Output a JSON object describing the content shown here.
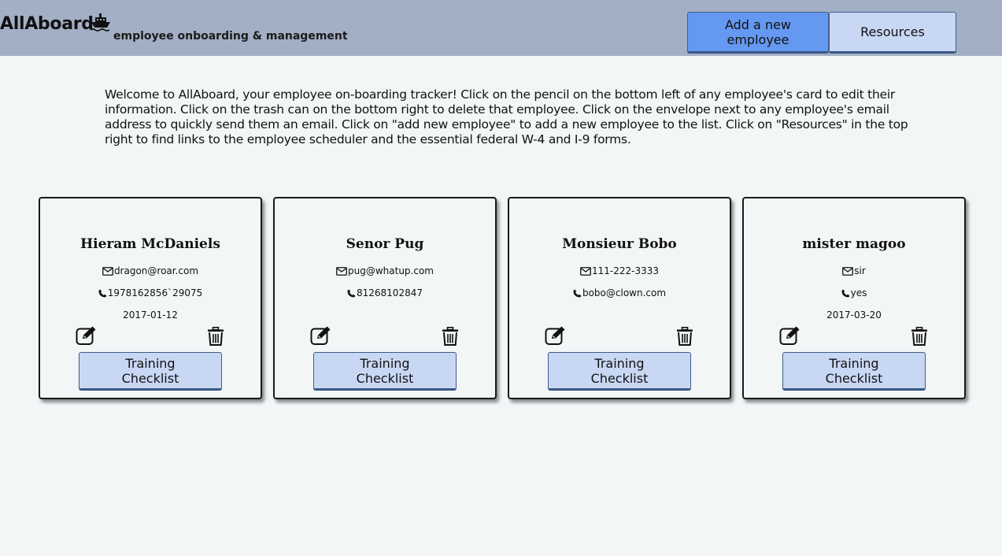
{
  "header": {
    "brand": "AllAboard",
    "tagline": "employee onboarding & management",
    "add_button": "Add a new employee",
    "resources_button": "Resources"
  },
  "welcome_text": "Welcome to AllAboard, your employee on-boarding tracker! Click on the pencil on the bottom left of any employee's card to edit their information. Click on the trash can on the bottom right to delete that employee. Click on the envelope next to any employee's email address to quickly send them an email. Click on \"add new employee\" to add a new employee to the list. Click on \"Resources\" in the top right to find links to the employee scheduler and the essential federal W-4 and I-9 forms.",
  "employees": [
    {
      "name": "Hieram McDaniels",
      "email": "dragon@roar.com",
      "phone": "1978162856`29075",
      "date": "2017-01-12",
      "button": "Training Checklist"
    },
    {
      "name": "Senor Pug",
      "email": "pug@whatup.com",
      "phone": "81268102847",
      "date": "",
      "button": "Training Checklist"
    },
    {
      "name": "Monsieur Bobo",
      "email": "111-222-3333",
      "phone": "bobo@clown.com",
      "date": "",
      "button": "Training Checklist"
    },
    {
      "name": "mister magoo",
      "email": "sir",
      "phone": "yes",
      "date": "2017-03-20",
      "button": "Training Checklist"
    }
  ],
  "colors": {
    "header_bg": "#a3afc4",
    "add_button_bg": "#6598f0",
    "secondary_button_bg": "#c8d8f4",
    "page_bg": "#f2f6f7"
  },
  "icons": [
    "ship-icon",
    "envelope-icon",
    "phone-icon",
    "edit-icon",
    "trash-icon"
  ]
}
